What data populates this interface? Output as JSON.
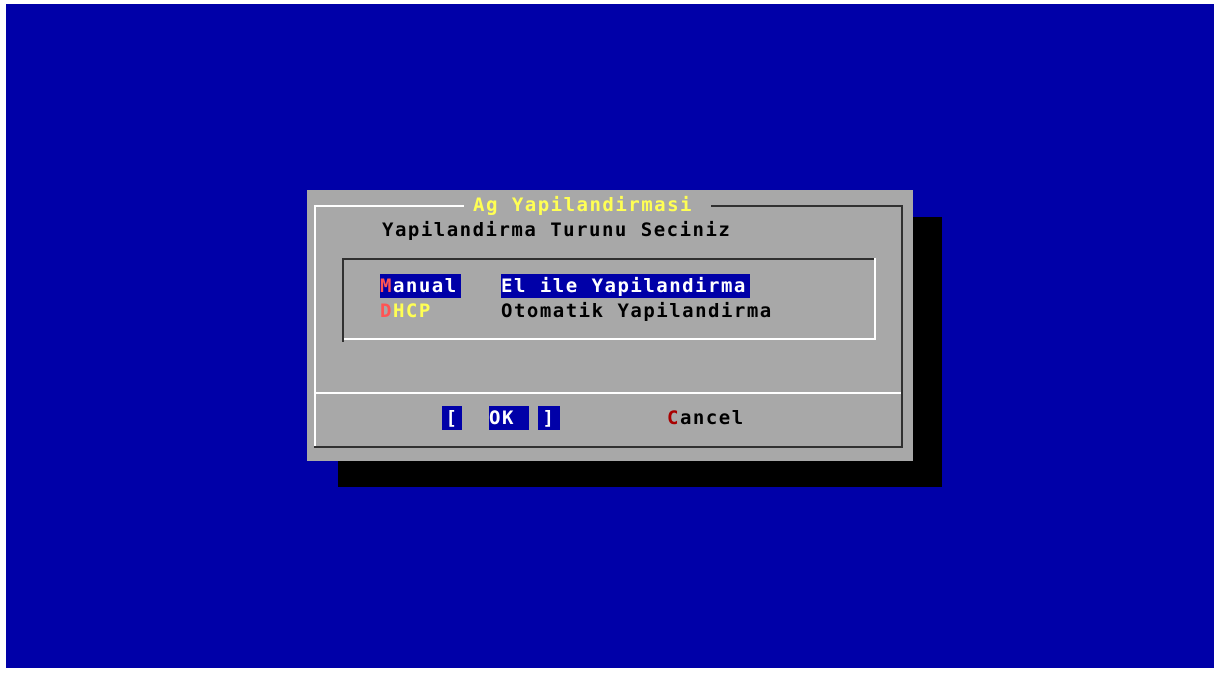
{
  "dialog": {
    "title": "Ag Yapilandirmasi",
    "prompt": "Yapilandirma Turunu Seciniz"
  },
  "menu": {
    "items": [
      {
        "tag_hot": "M",
        "tag_rest": "anual",
        "description": "El ile Yapilandirma",
        "selected": true
      },
      {
        "tag_hot": "D",
        "tag_rest": "HCP",
        "description": "Otomatik Yapilandirma",
        "selected": false
      }
    ]
  },
  "buttons": {
    "ok": {
      "left_bracket": "[",
      "hot": "O",
      "rest": "K",
      "right_bracket": "]"
    },
    "cancel": {
      "hot": "C",
      "rest": "ancel"
    }
  },
  "colors": {
    "background": "#0000a8",
    "dialog": "#a8a8a8",
    "title": "#ffff54",
    "highlight": "#0000a8",
    "hotkey": "#ff5454",
    "cancel_hotkey": "#a80000"
  }
}
